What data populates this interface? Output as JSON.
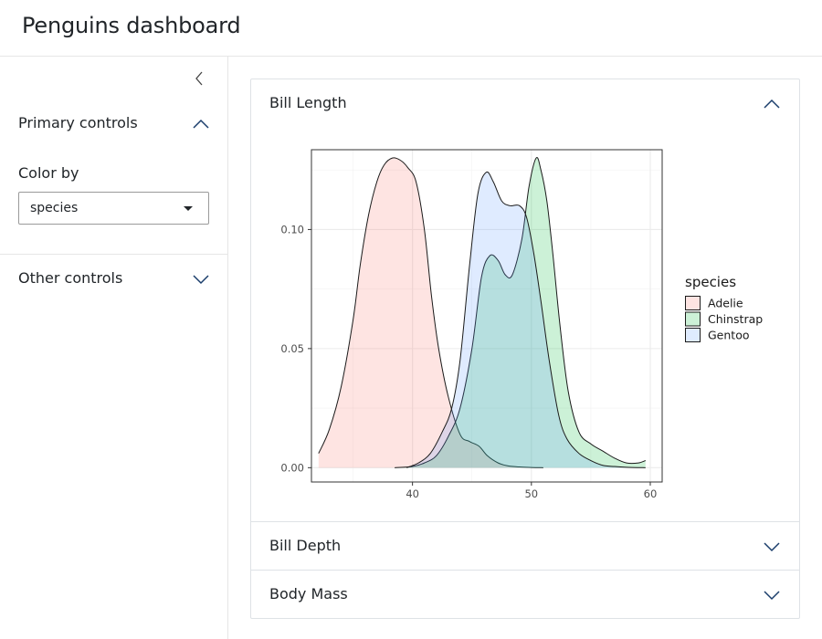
{
  "header": {
    "title": "Penguins dashboard"
  },
  "sidebar": {
    "primary_controls": "Primary controls",
    "color_by_label": "Color by",
    "color_by_value": "species",
    "other_controls": "Other controls"
  },
  "panels": {
    "bill_length": "Bill Length",
    "bill_depth": "Bill Depth",
    "body_mass": "Body Mass"
  },
  "colors": {
    "adelie": "#F8766D",
    "chinstrap": "#00BA38",
    "gentoo": "#619CFF",
    "accent": "#1a3d6b"
  },
  "icons": {
    "collapse": "chevron-left-icon",
    "expanded": "chevron-up-icon",
    "collapsed": "chevron-down-icon"
  },
  "chart_data": {
    "type": "area",
    "subtype": "density",
    "xlabel": "",
    "ylabel": "",
    "xlim": [
      31.5,
      61.0
    ],
    "ylim": [
      -0.006,
      0.1335
    ],
    "x_ticks": [
      40,
      50,
      60
    ],
    "y_ticks": [
      0.0,
      0.05,
      0.1
    ],
    "x_tick_labels": [
      "40",
      "50",
      "60"
    ],
    "y_tick_labels": [
      "0.00",
      "0.05",
      "0.10"
    ],
    "grid": true,
    "legend": {
      "title": "species",
      "position": "right",
      "labels": [
        "Adelie",
        "Chinstrap",
        "Gentoo"
      ]
    },
    "series": [
      {
        "name": "Adelie",
        "x": [
          32.1,
          33.0,
          34.0,
          35.0,
          35.6,
          36.3,
          37.0,
          37.6,
          38.3,
          39.0,
          39.6,
          40.3,
          41.0,
          41.6,
          42.2,
          43.0,
          44.0,
          44.8,
          45.6,
          46.3,
          47.2,
          48.0,
          49.0,
          50.0,
          51.0
        ],
        "y": [
          0.006,
          0.016,
          0.034,
          0.062,
          0.085,
          0.106,
          0.12,
          0.127,
          0.13,
          0.129,
          0.126,
          0.12,
          0.1,
          0.072,
          0.05,
          0.03,
          0.014,
          0.011,
          0.009,
          0.005,
          0.002,
          0.0008,
          0.0003,
          0.0001,
          0.0
        ]
      },
      {
        "name": "Chinstrap",
        "x": [
          38.5,
          40.0,
          41.0,
          42.0,
          43.0,
          44.0,
          45.0,
          45.8,
          46.5,
          47.2,
          47.8,
          48.4,
          49.2,
          49.8,
          50.4,
          50.8,
          51.3,
          51.8,
          52.4,
          53.1,
          54.0,
          55.0,
          56.0,
          57.0,
          58.0,
          59.0,
          59.6
        ],
        "y": [
          0.0,
          0.0005,
          0.002,
          0.005,
          0.013,
          0.025,
          0.05,
          0.08,
          0.089,
          0.087,
          0.081,
          0.081,
          0.096,
          0.118,
          0.13,
          0.125,
          0.112,
          0.09,
          0.06,
          0.032,
          0.015,
          0.01,
          0.007,
          0.004,
          0.002,
          0.002,
          0.003
        ]
      },
      {
        "name": "Gentoo",
        "x": [
          39.5,
          40.5,
          41.5,
          42.5,
          43.3,
          44.0,
          44.8,
          45.5,
          46.2,
          46.8,
          47.5,
          48.2,
          49.0,
          49.6,
          50.2,
          50.8,
          51.5,
          52.3,
          53.0,
          54.0,
          55.0,
          56.0,
          57.0,
          58.0,
          59.6
        ],
        "y": [
          0.0,
          0.002,
          0.006,
          0.015,
          0.025,
          0.045,
          0.085,
          0.115,
          0.124,
          0.12,
          0.112,
          0.11,
          0.11,
          0.105,
          0.09,
          0.07,
          0.045,
          0.022,
          0.012,
          0.006,
          0.003,
          0.001,
          0.0005,
          0.0002,
          0.0
        ]
      }
    ]
  }
}
